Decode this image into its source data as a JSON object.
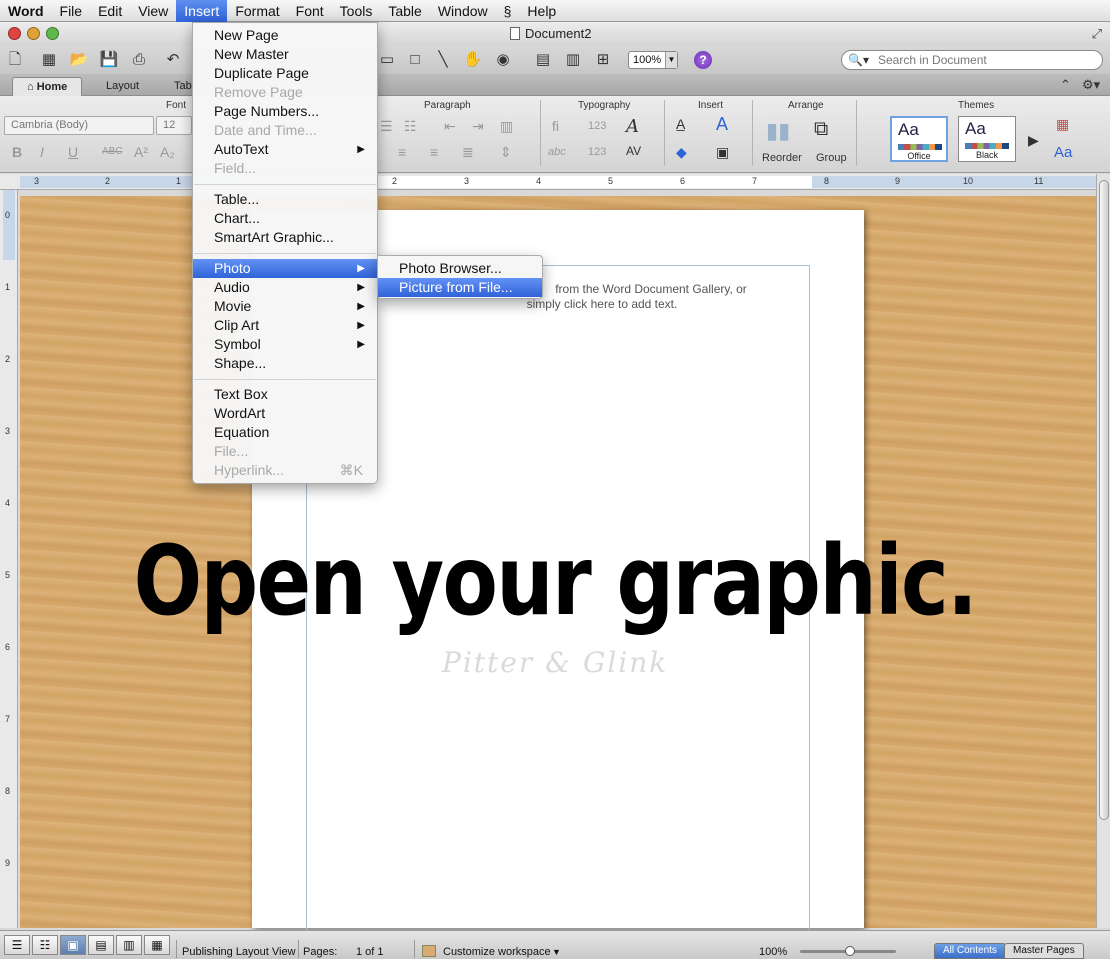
{
  "menubar": {
    "app": "Word",
    "items": [
      "File",
      "Edit",
      "View",
      "Insert",
      "Format",
      "Font",
      "Tools",
      "Table",
      "Window",
      "Help"
    ],
    "active": "Insert"
  },
  "window": {
    "title": "Document2"
  },
  "toolbar": {
    "zoom": "100%",
    "search_placeholder": "Search in Document"
  },
  "ribbon": {
    "tabs": [
      "Home",
      "Layout",
      "Tab"
    ],
    "active_tab": "Home",
    "groups": {
      "font": "Font",
      "paragraph": "Paragraph",
      "typography": "Typography",
      "insert": "Insert",
      "arrange": "Arrange",
      "themes": "Themes"
    },
    "font_name": "Cambria (Body)",
    "font_size": "12",
    "arrange_buttons": {
      "reorder": "Reorder",
      "group": "Group"
    },
    "themes": [
      {
        "sample": "Aa",
        "name": "Office"
      },
      {
        "sample": "Aa",
        "name": "Black"
      }
    ],
    "more_theme_sample": "Aa"
  },
  "ruler": {
    "h_numbers": [
      "3",
      "2",
      "1",
      "2",
      "3",
      "4",
      "5",
      "6",
      "7",
      "8",
      "9",
      "10",
      "11"
    ],
    "v_numbers": [
      "0",
      "1",
      "2",
      "3",
      "4",
      "5",
      "6",
      "7",
      "8",
      "9"
    ]
  },
  "insert_menu": {
    "items": [
      {
        "label": "New Page",
        "enabled": true
      },
      {
        "label": "New Master",
        "enabled": true
      },
      {
        "label": "Duplicate Page",
        "enabled": true
      },
      {
        "label": "Remove Page",
        "enabled": false
      },
      {
        "label": "Page Numbers...",
        "enabled": true
      },
      {
        "label": "Date and Time...",
        "enabled": false
      },
      {
        "label": "AutoText",
        "enabled": true,
        "submenu": true
      },
      {
        "label": "Field...",
        "enabled": false
      },
      {
        "label": "Table...",
        "enabled": true
      },
      {
        "label": "Chart...",
        "enabled": true
      },
      {
        "label": "SmartArt Graphic...",
        "enabled": true
      },
      {
        "label": "Photo",
        "enabled": true,
        "submenu": true,
        "highlighted": true
      },
      {
        "label": "Audio",
        "enabled": true,
        "submenu": true
      },
      {
        "label": "Movie",
        "enabled": true,
        "submenu": true
      },
      {
        "label": "Clip Art",
        "enabled": true,
        "submenu": true
      },
      {
        "label": "Symbol",
        "enabled": true,
        "submenu": true
      },
      {
        "label": "Shape...",
        "enabled": true
      },
      {
        "label": "Text Box",
        "enabled": true
      },
      {
        "label": "WordArt",
        "enabled": true
      },
      {
        "label": "Equation",
        "enabled": true
      },
      {
        "label": "File...",
        "enabled": false
      },
      {
        "label": "Hyperlink...",
        "enabled": false,
        "shortcut": "⌘K"
      }
    ],
    "submenu_arrow": "▶"
  },
  "photo_submenu": {
    "items": [
      {
        "label": "Photo Browser...",
        "highlighted": false
      },
      {
        "label": "Picture from File...",
        "highlighted": true
      }
    ]
  },
  "document": {
    "placeholder_line1": "from the Word Document Gallery, or",
    "placeholder_line2": "simply click here to add text.",
    "watermark": "Pitter & Glink"
  },
  "caption": "Open your graphic.",
  "statusbar": {
    "view": "Publishing Layout View",
    "pages_label": "Pages:",
    "pages_value": "1 of 1",
    "workspace": "Customize workspace",
    "zoom": "100%",
    "tabs": [
      "All Contents",
      "Master Pages"
    ]
  }
}
